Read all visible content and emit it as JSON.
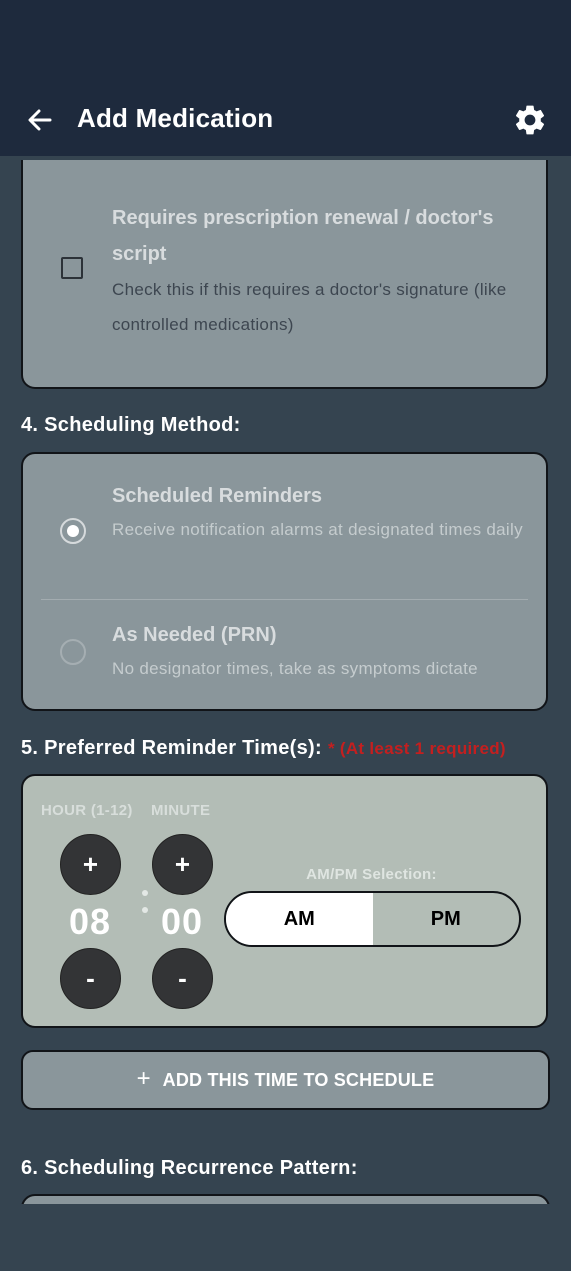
{
  "app_bar": {
    "title": "Add Medication",
    "back_icon": "arrow-left-icon",
    "settings_icon": "gear-icon"
  },
  "prescription": {
    "title": "Requires prescription renewal / doctor's script",
    "description": "Check this if this requires a doctor's signature (like controlled medications)",
    "checked": false
  },
  "scheduling_method": {
    "label": "4. Scheduling Method:",
    "options": [
      {
        "title": "Scheduled Reminders",
        "description": "Receive notification alarms at designated times daily",
        "selected": true
      },
      {
        "title": "As Needed (PRN)",
        "description": "No designator times, take as symptoms dictate",
        "selected": false
      }
    ]
  },
  "reminder_time": {
    "label": "5. Preferred Reminder Time(s):",
    "required_note": "* (At least 1 required)",
    "hour_label": "HOUR (1-12)",
    "minute_label": "MINUTE",
    "hour_value": "08",
    "minute_value": "00",
    "plus": "+",
    "minus": "-",
    "ampm_label": "AM/PM Selection:",
    "am": "AM",
    "pm": "PM",
    "selected_period": "AM"
  },
  "add_time_button": {
    "icon": "plus-icon",
    "plus_glyph": "+",
    "label": "ADD THIS TIME TO SCHEDULE"
  },
  "recurrence": {
    "label": "6. Scheduling Recurrence Pattern:"
  },
  "colors": {
    "app_bar": "#1e2a3d",
    "background": "#354450",
    "card": "#8a969b",
    "time_card": "#b3bdb6",
    "required": "#c41f1f"
  }
}
